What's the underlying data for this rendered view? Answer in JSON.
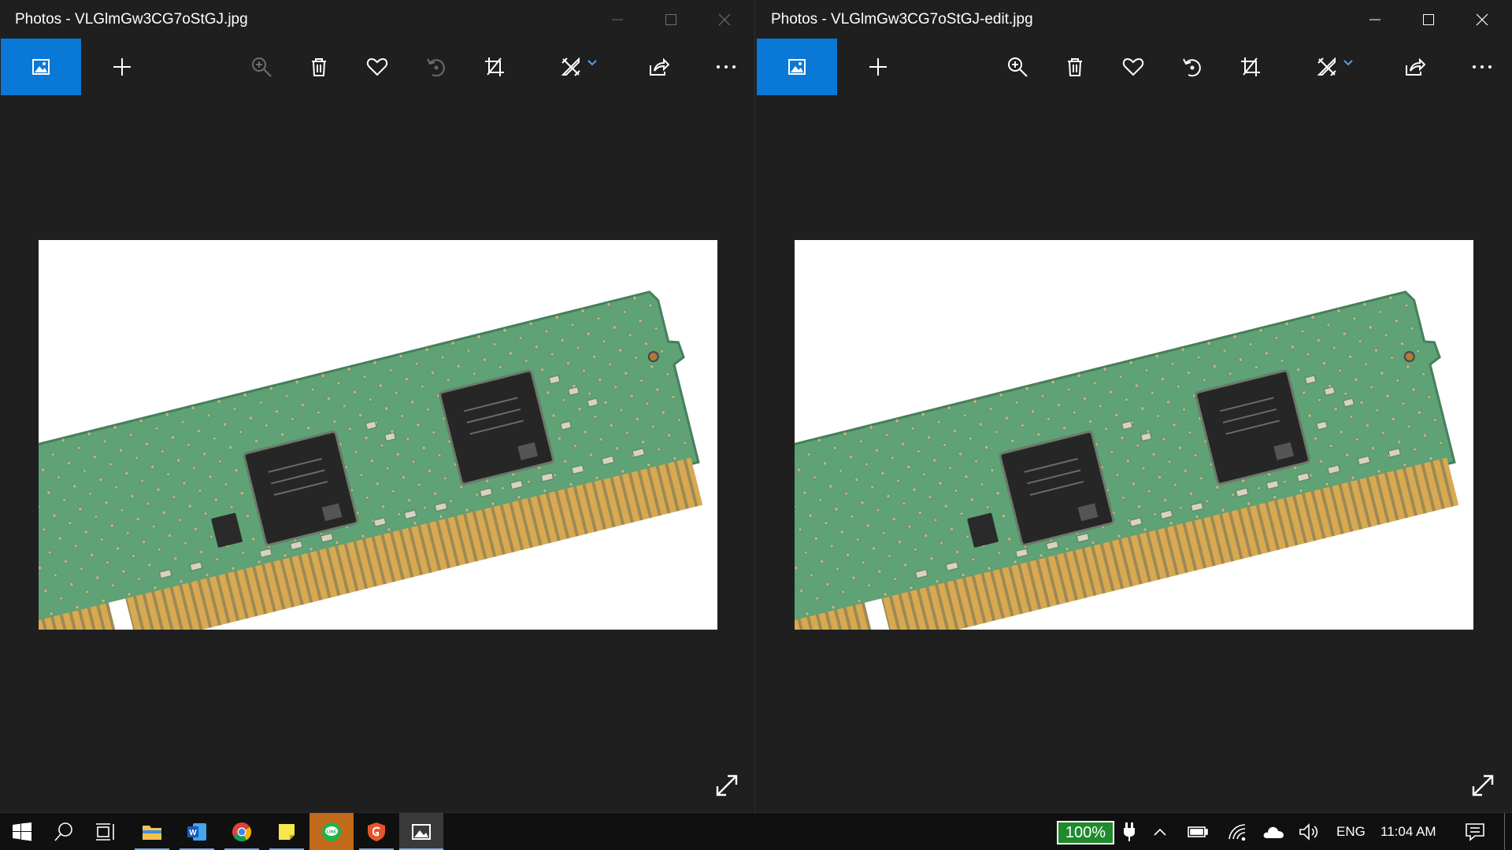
{
  "left_window": {
    "title": "Photos - VLGlmGw3CG7oStGJ.jpg",
    "state": "inactive",
    "toolbar": [
      "view-icon",
      "add-icon",
      "zoom-in-icon",
      "delete-icon",
      "favorite-icon",
      "rotate-icon",
      "crop-icon",
      "edit-icon",
      "share-icon",
      "more-icon"
    ],
    "image_subject": "RAM memory module"
  },
  "right_window": {
    "title": "Photos - VLGlmGw3CG7oStGJ-edit.jpg",
    "state": "active",
    "toolbar": [
      "view-icon",
      "add-icon",
      "zoom-in-icon",
      "delete-icon",
      "favorite-icon",
      "rotate-icon",
      "crop-icon",
      "edit-icon",
      "share-icon",
      "more-icon"
    ],
    "image_subject": "RAM memory module"
  },
  "taskbar": {
    "apps": [
      "start-icon",
      "search-icon",
      "task-view-icon",
      "file-explorer-icon",
      "word-icon",
      "chrome-icon",
      "sticky-notes-icon",
      "line-icon",
      "guardian-icon",
      "photos-icon"
    ],
    "battery_percent": "100%",
    "language": "ENG",
    "time": "11:04 AM"
  },
  "colors": {
    "accent": "#0a78d7",
    "window_bg": "#1f1f1f",
    "taskbar_bg": "#101010",
    "battery_badge": "#1e8a2c",
    "pcb_green": "#5aa072",
    "gold_contacts": "#d4a548"
  }
}
